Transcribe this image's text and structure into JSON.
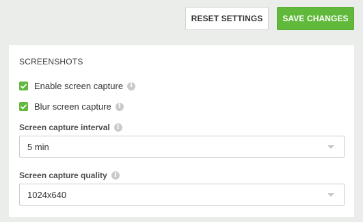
{
  "toolbar": {
    "reset_label": "RESET SETTINGS",
    "save_label": "SAVE CHANGES"
  },
  "screenshots": {
    "section_title": "SCREENSHOTS",
    "enable_capture": {
      "label": "Enable screen capture",
      "checked": true
    },
    "blur_capture": {
      "label": "Blur screen capture",
      "checked": true
    },
    "interval": {
      "label": "Screen capture interval",
      "value": "5 min"
    },
    "quality": {
      "label": "Screen capture quality",
      "value": "1024x640"
    }
  },
  "icons": {
    "info": "info-icon",
    "check": "checkmark-icon",
    "dropdown": "chevron-down-icon"
  },
  "colors": {
    "accent": "#61b93b",
    "background": "#ebedeb",
    "panel": "#ffffff"
  }
}
